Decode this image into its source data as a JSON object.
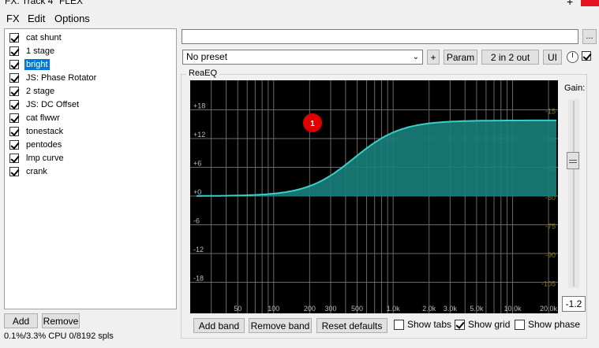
{
  "window": {
    "title": "FX: Track 4 \"FLEX\"",
    "plus_glyph": "+"
  },
  "menu": [
    "FX",
    "Edit",
    "Options"
  ],
  "fx_chain": [
    {
      "label": "cat shunt",
      "enabled": true,
      "selected": false
    },
    {
      "label": "1 stage",
      "enabled": true,
      "selected": false
    },
    {
      "label": "bright",
      "enabled": true,
      "selected": true
    },
    {
      "label": "JS: Phase Rotator",
      "enabled": true,
      "selected": false
    },
    {
      "label": "2 stage",
      "enabled": true,
      "selected": false
    },
    {
      "label": "JS: DC Offset",
      "enabled": true,
      "selected": false
    },
    {
      "label": "cat flwwr",
      "enabled": true,
      "selected": false
    },
    {
      "label": "tonestack",
      "enabled": true,
      "selected": false
    },
    {
      "label": "pentodes",
      "enabled": true,
      "selected": false
    },
    {
      "label": "lmp curve",
      "enabled": true,
      "selected": false
    },
    {
      "label": "crank",
      "enabled": true,
      "selected": false
    }
  ],
  "buttons": {
    "add": "Add",
    "remove": "Remove",
    "plus": "+",
    "param": "Param",
    "io": "2 in 2 out",
    "ui": "UI",
    "browse": "...",
    "add_band": "Add band",
    "remove_band": "Remove band",
    "reset_defaults": "Reset defaults"
  },
  "status": {
    "cpu": "0.1%/3.3% CPU 0/8192 spls"
  },
  "preset": {
    "value": "No preset",
    "chevron": "⌄"
  },
  "plugin": {
    "name": "ReaEQ"
  },
  "eq": {
    "db_labels_left": [
      "+18",
      "+12",
      "+6",
      "+0",
      "-6",
      "-12",
      "-18"
    ],
    "db_labels_right": [
      "-15",
      "-30",
      "-45",
      "-60",
      "-75",
      "-90",
      "-105"
    ],
    "freq_labels": [
      "50",
      "100",
      "200",
      "300",
      "500",
      "1.0k",
      "2.0k",
      "3.0k",
      "5.0k",
      "10.0k",
      "20.0k"
    ],
    "band_marker": "1",
    "fill_color": "#1a7f7b",
    "curve_color": "#39d0c8",
    "marker_color": "#e00000"
  },
  "gain": {
    "label": "Gain:",
    "value": "-1.2"
  },
  "options": {
    "show_tabs": {
      "label": "Show tabs",
      "checked": false
    },
    "show_grid": {
      "label": "Show grid",
      "checked": true
    },
    "show_phase": {
      "label": "Show phase",
      "checked": false
    }
  },
  "top_checkbox": {
    "checked": true
  }
}
